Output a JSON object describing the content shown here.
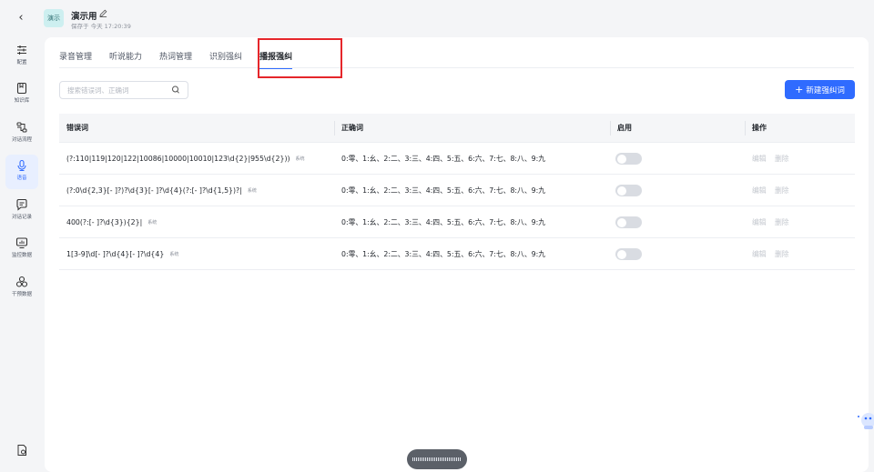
{
  "header": {
    "back_icon": "chevron-left-icon",
    "app_badge": "演示",
    "app_title": "演示用",
    "saved_text": "保存于 今天 17:20:39"
  },
  "sidebar": {
    "items": [
      {
        "label": "配置",
        "icon": "sliders-icon"
      },
      {
        "label": "知识库",
        "icon": "book-icon"
      },
      {
        "label": "对话流程",
        "icon": "flow-icon"
      },
      {
        "label": "语音",
        "icon": "microphone-icon",
        "active": true
      },
      {
        "label": "对话记录",
        "icon": "chat-icon"
      },
      {
        "label": "监控数据",
        "icon": "monitor-icon"
      },
      {
        "label": "干预数据",
        "icon": "nodes-icon"
      }
    ],
    "bottom_icon": "settings-file-icon"
  },
  "tabs": [
    {
      "label": "录音管理"
    },
    {
      "label": "听说能力"
    },
    {
      "label": "热词管理"
    },
    {
      "label": "识别强纠"
    },
    {
      "label": "播报强纠",
      "active": true
    }
  ],
  "search": {
    "placeholder": "搜索错误词、正确词",
    "value": ""
  },
  "new_button": {
    "label": "新建强纠词"
  },
  "table": {
    "headers": {
      "wrong": "错误词",
      "correct": "正确词",
      "enabled": "启用",
      "actions": "操作"
    },
    "rows": [
      {
        "wrong": "(?:110|119|120|122|10086|10000|10010|123\\d{2}|955\\d{2}))",
        "tag": "系统",
        "correct": "0:零、1:幺、2:二、3:三、4:四、5:五、6:六、7:七、8:八、9:九",
        "enabled": false,
        "edit": "编辑",
        "delete": "删除"
      },
      {
        "wrong": "(?:0\\d{2,3}[- ]?)?\\d{3}[- ]?\\d{4}(?:[- ]?\\d{1,5})?|",
        "tag": "系统",
        "correct": "0:零、1:幺、2:二、3:三、4:四、5:五、6:六、7:七、8:八、9:九",
        "enabled": false,
        "edit": "编辑",
        "delete": "删除"
      },
      {
        "wrong": "400(?:[- ]?\\d{3}){2}|",
        "tag": "系统",
        "correct": "0:零、1:幺、2:二、3:三、4:四、5:五、6:六、7:七、8:八、9:九",
        "enabled": false,
        "edit": "编辑",
        "delete": "删除"
      },
      {
        "wrong": "1[3-9]\\d[- ]?\\d{4}[- ]?\\d{4}",
        "tag": "系统",
        "correct": "0:零、1:幺、2:二、3:三、4:四、5:五、6:六、7:七、8:八、9:九",
        "enabled": false,
        "edit": "编辑",
        "delete": "删除"
      }
    ]
  },
  "colors": {
    "accent": "#2f6bff",
    "highlight": "#e5262b",
    "toggle_off": "#d9dce2"
  }
}
